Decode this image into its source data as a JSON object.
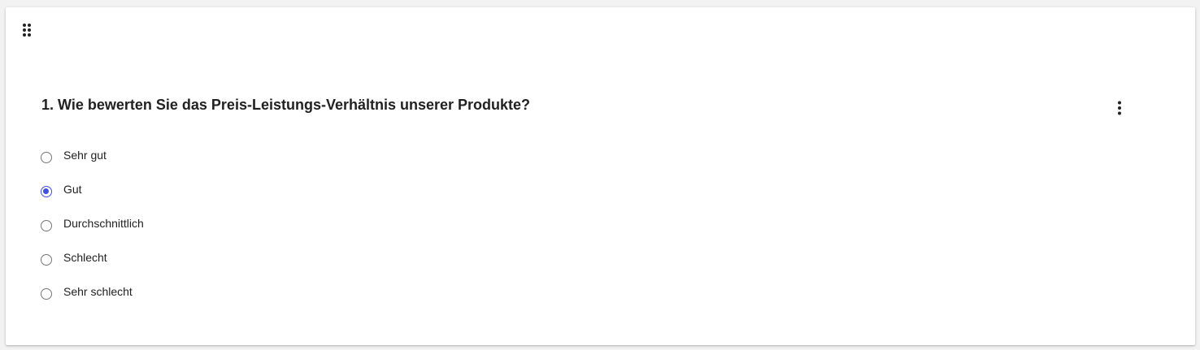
{
  "question": {
    "title": "1. Wie bewerten Sie das Preis-Leistungs-Verhältnis unserer Produkte?",
    "options": [
      {
        "label": "Sehr gut",
        "selected": false
      },
      {
        "label": "Gut",
        "selected": true
      },
      {
        "label": "Durchschnittlich",
        "selected": false
      },
      {
        "label": "Schlecht",
        "selected": false
      },
      {
        "label": "Sehr schlecht",
        "selected": false
      }
    ]
  },
  "icons": {
    "drag": "drag-handle-icon",
    "menu": "more-vert-icon"
  },
  "colors": {
    "accent": "#3f51d6",
    "text": "#212121",
    "radio_border": "#757575"
  }
}
